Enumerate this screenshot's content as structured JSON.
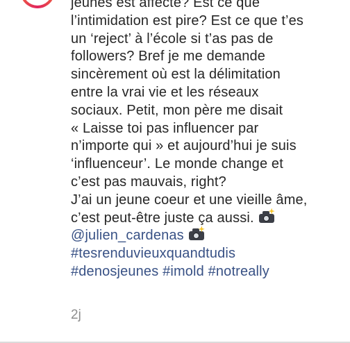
{
  "comment": {
    "author_avatar_icon": "avatar-story-ring",
    "caption_lines": [
      "jeunes est affecté? Est ce que",
      "l’intimidation est pire? Est ce que t’es",
      "un ‘reject’ à l’école si t’as pas de",
      "followers? Bref je me demande",
      "sincèrement où est la délimitation",
      "entre la vrai vie et les réseaux",
      "sociaux. Petit, mon père me disait",
      "« Laisse toi pas influencer par",
      "n’importe qui » et aujourd’hui je suis",
      "‘influenceur’. Le monde change et",
      "c’est pas mauvais, right?",
      "J’ai un jeune coeur et une vieille âme,",
      "c’est peut-être juste ça aussi."
    ],
    "mention": "@julien_cardenas",
    "hashtags_line1": [
      "#tesrenduvieuxquandtudis"
    ],
    "hashtags_line2": [
      "#denosjeunes",
      "#imold",
      "#notreally"
    ],
    "emoji_icon": "camera-with-flash-icon",
    "timestamp": "2j",
    "link_color": "#385185",
    "text_color": "#262626",
    "meta_color": "#8e8e8e"
  }
}
